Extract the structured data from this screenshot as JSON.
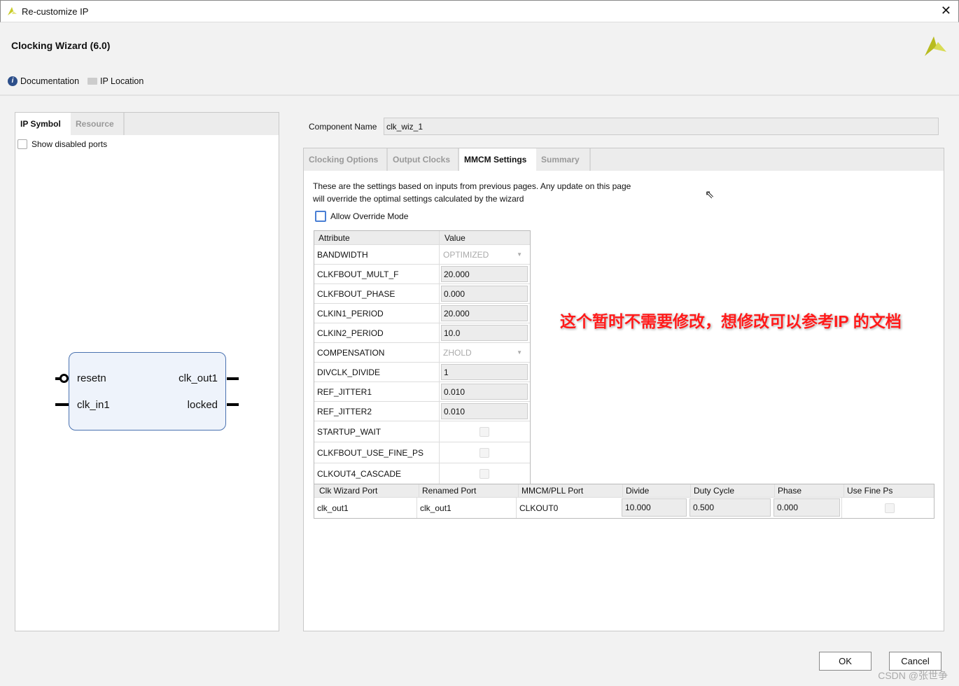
{
  "window": {
    "title": "Re-customize IP",
    "close_icon": "close-icon"
  },
  "header": {
    "title": "Clocking Wizard (6.0)",
    "documentation": "Documentation",
    "ip_location": "IP Location"
  },
  "left": {
    "tabs": [
      "IP Symbol",
      "Resource"
    ],
    "show_disabled_ports": "Show disabled ports",
    "symbol": {
      "left_ports": [
        "resetn",
        "clk_in1"
      ],
      "right_ports": [
        "clk_out1",
        "locked"
      ]
    }
  },
  "component": {
    "label": "Component Name",
    "value": "clk_wiz_1"
  },
  "tabs": [
    "Clocking Options",
    "Output Clocks",
    "MMCM Settings",
    "Summary"
  ],
  "active_tab": "MMCM Settings",
  "description": [
    "These are the settings based on inputs from previous pages. Any update on this page",
    "will override the optimal settings calculated by the wizard"
  ],
  "override_label": "Allow Override Mode",
  "attr_table": {
    "headers": [
      "Attribute",
      "Value"
    ],
    "rows": [
      {
        "name": "BANDWIDTH",
        "value": "OPTIMIZED",
        "type": "combo"
      },
      {
        "name": "CLKFBOUT_MULT_F",
        "value": "20.000",
        "type": "field"
      },
      {
        "name": "CLKFBOUT_PHASE",
        "value": "0.000",
        "type": "field"
      },
      {
        "name": "CLKIN1_PERIOD",
        "value": "20.000",
        "type": "field"
      },
      {
        "name": "CLKIN2_PERIOD",
        "value": "10.0",
        "type": "field"
      },
      {
        "name": "COMPENSATION",
        "value": "ZHOLD",
        "type": "combo"
      },
      {
        "name": "DIVCLK_DIVIDE",
        "value": "1",
        "type": "field"
      },
      {
        "name": "REF_JITTER1",
        "value": "0.010",
        "type": "field"
      },
      {
        "name": "REF_JITTER2",
        "value": "0.010",
        "type": "field"
      },
      {
        "name": "STARTUP_WAIT",
        "value": false,
        "type": "check"
      },
      {
        "name": "CLKFBOUT_USE_FINE_PS",
        "value": false,
        "type": "check"
      },
      {
        "name": "CLKOUT4_CASCADE",
        "value": false,
        "type": "check"
      }
    ]
  },
  "port_table": {
    "headers": [
      "Clk Wizard Port",
      "Renamed Port",
      "MMCM/PLL Port",
      "Divide",
      "Duty Cycle",
      "Phase",
      "Use Fine Ps"
    ],
    "rows": [
      [
        "clk_out1",
        "clk_out1",
        "CLKOUT0",
        "10.000",
        "0.500",
        "0.000",
        false
      ]
    ]
  },
  "annotation": "这个暂时不需要修改，想修改可以参考IP 的文档",
  "buttons": {
    "ok": "OK",
    "cancel": "Cancel"
  },
  "watermark": "CSDN @张世争",
  "colors": {
    "annotation": "#ff1a1a",
    "symbol_border": "#4a72b0",
    "symbol_fill": "#eef3fb",
    "logo": "#c9cc2a"
  }
}
